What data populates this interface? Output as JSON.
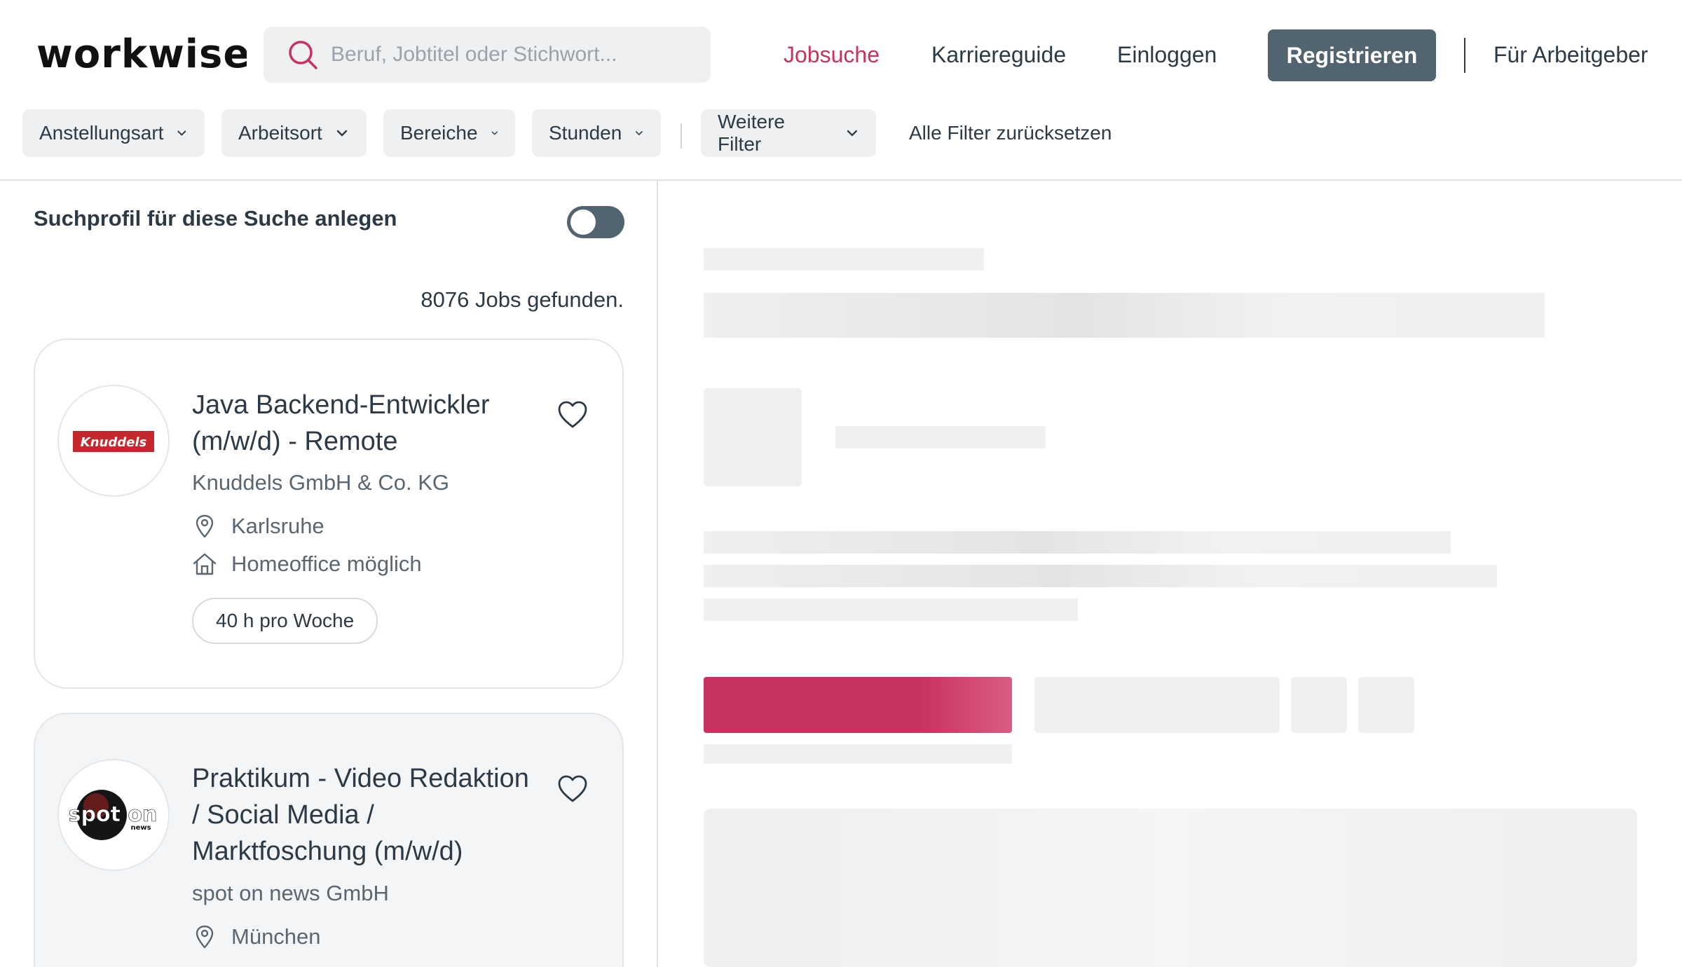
{
  "header": {
    "logo_text": "workwise",
    "search_placeholder": "Beruf, Jobtitel oder Stichwort...",
    "nav": {
      "jobsuche": "Jobsuche",
      "karriereguide": "Karriereguide",
      "einloggen": "Einloggen",
      "registrieren": "Registrieren",
      "arbeitgeber": "Für Arbeitgeber"
    }
  },
  "filters": {
    "anstellungsart": "Anstellungsart",
    "arbeitsort": "Arbeitsort",
    "bereiche": "Bereiche",
    "stunden": "Stunden",
    "weitere": "Weitere Filter",
    "reset": "Alle Filter zurücksetzen"
  },
  "list": {
    "profile_label": "Suchprofil für diese Suche anlegen",
    "profile_toggle_on": false,
    "jobs_count": "8076 Jobs gefunden.",
    "jobs": [
      {
        "title_line1": "Java Backend-Entwickler",
        "title_line2": "(m/w/d) - Remote",
        "company": "Knuddels GmbH & Co. KG",
        "logo_text": "Knuddels",
        "location": "Karlsruhe",
        "homeoffice": "Homeoffice möglich",
        "hours": "40 h pro Woche"
      },
      {
        "title_line1": "Praktikum - Video Redaktion",
        "title_line2": "/ Social Media /",
        "title_line3": "Marktfoschung (m/w/d)",
        "company": "spot on news GmbH",
        "logo_text": "spot on",
        "logo_subtext": "news",
        "location": "München"
      }
    ]
  },
  "colors": {
    "accent": "#c8325e",
    "button_dark": "#526470",
    "text": "#2d3a45",
    "filter_bg": "#eef0f2"
  }
}
